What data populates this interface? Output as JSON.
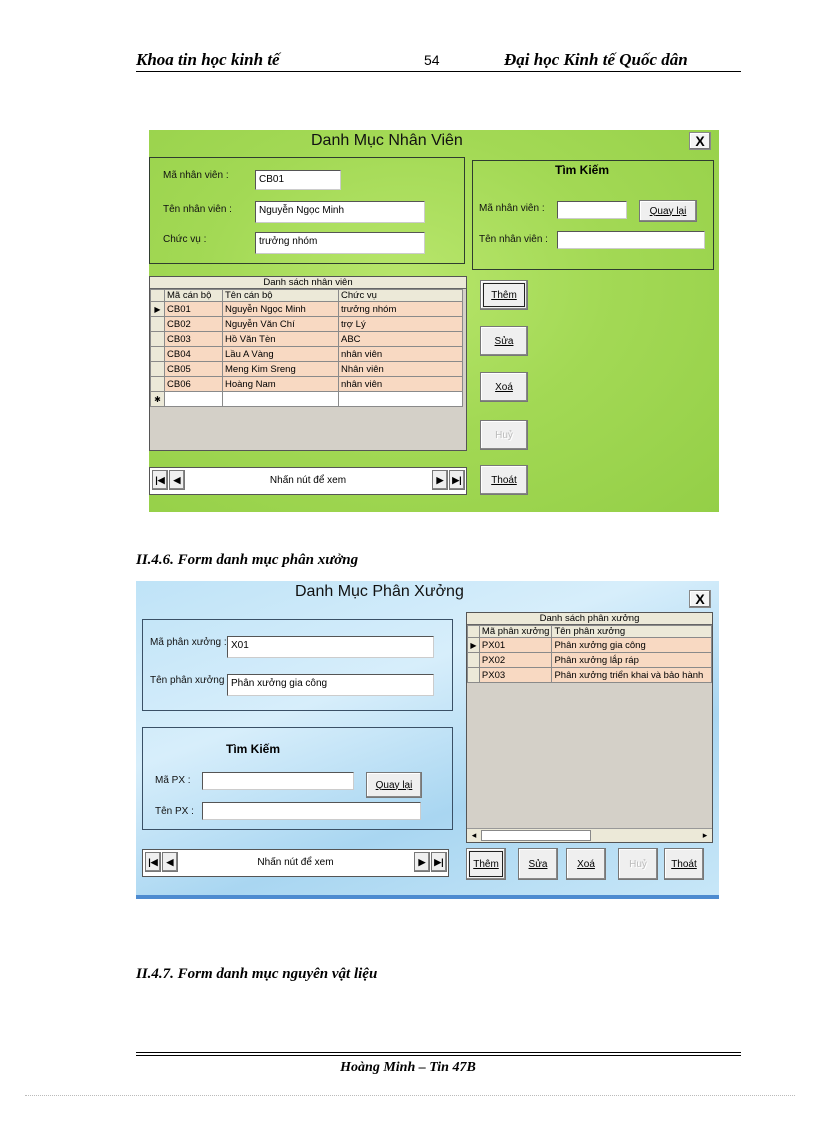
{
  "header": {
    "left": "Khoa tin học kinh tế",
    "page_number": "54",
    "right": "Đại học Kinh tế Quốc dân"
  },
  "form1": {
    "title": "Danh Mục Nhân Viên",
    "close": "X",
    "fields": {
      "ma_label": "Mã nhân viên :",
      "ma_value": "CB01",
      "ten_label": "Tên nhân viên :",
      "ten_value": "Nguyễn Ngọc Minh",
      "chucvu_label": "Chức vụ :",
      "chucvu_value": "trưởng nhóm"
    },
    "search": {
      "title": "Tìm Kiếm",
      "ma_label": "Mã nhân viên :",
      "ma_value": "",
      "ten_label": "Tên nhân viên :",
      "ten_value": "",
      "back_button": "Quay lại"
    },
    "grid": {
      "caption": "Danh sách nhân viên",
      "columns": [
        "Mã cán bộ",
        "Tên cán bộ",
        "Chức vụ"
      ],
      "rows": [
        [
          "CB01",
          "Nguyễn Ngọc Minh",
          "trưởng nhóm"
        ],
        [
          "CB02",
          "Nguyễn Văn Chí",
          "trợ Lý"
        ],
        [
          "CB03",
          "Hồ Văn Tèn",
          "ABC"
        ],
        [
          "CB04",
          "Lầu A Vàng",
          "nhân viên"
        ],
        [
          "CB05",
          "Meng Kim Sreng",
          "Nhân viên"
        ],
        [
          "CB06",
          "Hoàng Nam",
          "nhân viên"
        ]
      ],
      "current_marker": "▶",
      "new_marker": "✱"
    },
    "nav": {
      "text": "Nhấn nút để xem",
      "first": "|◀",
      "prev": "◀",
      "next": "▶",
      "last": "▶|"
    },
    "buttons": {
      "add": "Thêm",
      "edit": "Sửa",
      "delete": "Xoá",
      "cancel": "Huỷ",
      "exit": "Thoát"
    }
  },
  "section1": "II.4.6.    Form danh mục phân xưởng",
  "form2": {
    "title": "Danh Mục Phân Xưởng",
    "close": "X",
    "fields": {
      "ma_label": "Mã phân xưởng :",
      "ma_value": "X01",
      "ten_label": "Tên phân xưởng :",
      "ten_value": "Phân xưởng gia công"
    },
    "search": {
      "title": "Tìm Kiếm",
      "ma_label": "Mã PX :",
      "ma_value": "",
      "ten_label": "Tên PX :",
      "ten_value": "",
      "back_button": "Quay lại"
    },
    "grid": {
      "caption": "Danh sách phân xưởng",
      "columns": [
        "Mã phân xưởng",
        "Tên phân xưởng"
      ],
      "rows": [
        [
          "PX01",
          "Phân xưởng gia công"
        ],
        [
          "PX02",
          "Phân xưởng lắp ráp"
        ],
        [
          "PX03",
          "Phân xưởng triển khai và bảo hành"
        ]
      ],
      "current_marker": "▶",
      "scroll_left": "◂",
      "scroll_right": "▸"
    },
    "nav": {
      "text": "Nhấn nút để xem",
      "first": "|◀",
      "prev": "◀",
      "next": "▶",
      "last": "▶|"
    },
    "buttons": {
      "add": "Thêm",
      "edit": "Sửa",
      "delete": "Xoá",
      "cancel": "Huỷ",
      "exit": "Thoát"
    }
  },
  "section2": "II.4.7. Form danh mục nguyên vật liệu",
  "footer": {
    "author": "Hoàng Minh – Tin 47B"
  }
}
